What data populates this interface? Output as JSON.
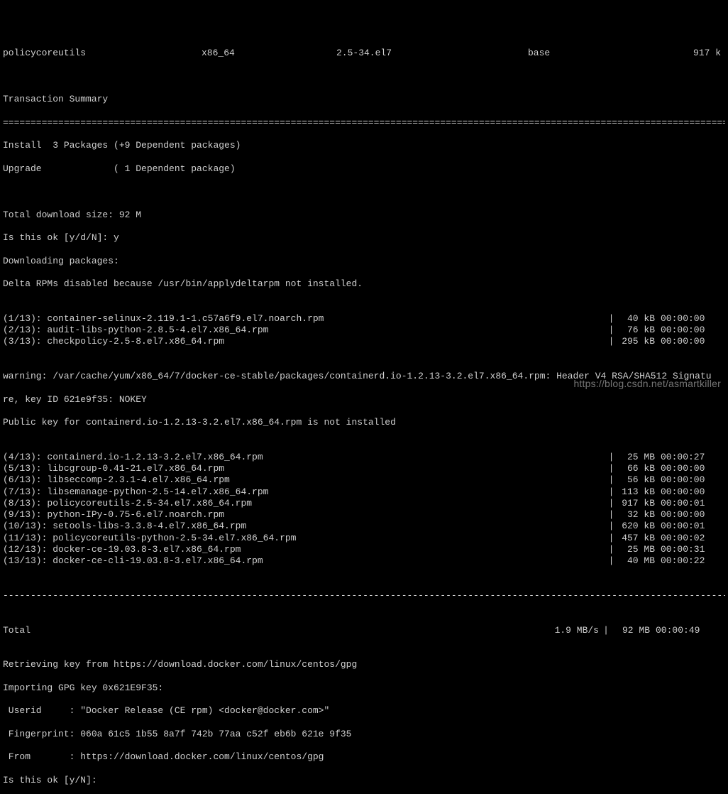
{
  "header": {
    "name": "policycoreutils",
    "arch": "x86_64",
    "version": "2.5-34.el7",
    "repo": "base",
    "size": "917 k"
  },
  "summary_title": "Transaction Summary",
  "divider": "========================================================================================================================================",
  "install_line": "Install  3 Packages (+9 Dependent packages)",
  "upgrade_line": "Upgrade             ( 1 Dependent package)",
  "download_size": "Total download size: 92 M",
  "prompt1": "Is this ok [y/d/N]: y",
  "downloading": "Downloading packages:",
  "delta_warn": "Delta RPMs disabled because /usr/bin/applydeltarpm not installed.",
  "pkgs": [
    {
      "label": "(1/13): container-selinux-2.119.1-1.c57a6f9.el7.noarch.rpm",
      "size": "40 kB",
      "time": "00:00:00"
    },
    {
      "label": "(2/13): audit-libs-python-2.8.5-4.el7.x86_64.rpm",
      "size": "76 kB",
      "time": "00:00:00"
    },
    {
      "label": "(3/13): checkpolicy-2.5-8.el7.x86_64.rpm",
      "size": "295 kB",
      "time": "00:00:00"
    }
  ],
  "warn1": "warning: /var/cache/yum/x86_64/7/docker-ce-stable/packages/containerd.io-1.2.13-3.2.el7.x86_64.rpm: Header V4 RSA/SHA512 Signatu",
  "warn2": "re, key ID 621e9f35: NOKEY",
  "pubkey": "Public key for containerd.io-1.2.13-3.2.el7.x86_64.rpm is not installed",
  "pkgs2": [
    {
      "label": "(4/13): containerd.io-1.2.13-3.2.el7.x86_64.rpm",
      "size": "25 MB",
      "time": "00:00:27"
    },
    {
      "label": "(5/13): libcgroup-0.41-21.el7.x86_64.rpm",
      "size": "66 kB",
      "time": "00:00:00"
    },
    {
      "label": "(6/13): libseccomp-2.3.1-4.el7.x86_64.rpm",
      "size": "56 kB",
      "time": "00:00:00"
    },
    {
      "label": "(7/13): libsemanage-python-2.5-14.el7.x86_64.rpm",
      "size": "113 kB",
      "time": "00:00:00"
    },
    {
      "label": "(8/13): policycoreutils-2.5-34.el7.x86_64.rpm",
      "size": "917 kB",
      "time": "00:00:01"
    },
    {
      "label": "(9/13): python-IPy-0.75-6.el7.noarch.rpm",
      "size": "32 kB",
      "time": "00:00:00"
    },
    {
      "label": "(10/13): setools-libs-3.3.8-4.el7.x86_64.rpm",
      "size": "620 kB",
      "time": "00:00:01"
    },
    {
      "label": "(11/13): policycoreutils-python-2.5-34.el7.x86_64.rpm",
      "size": "457 kB",
      "time": "00:00:02"
    },
    {
      "label": "(12/13): docker-ce-19.03.8-3.el7.x86_64.rpm",
      "size": "25 MB",
      "time": "00:00:31"
    },
    {
      "label": "(13/13): docker-ce-cli-19.03.8-3.el7.x86_64.rpm",
      "size": "40 MB",
      "time": "00:00:22"
    }
  ],
  "dash_divider": "----------------------------------------------------------------------------------------------------------------------------------------",
  "total": {
    "label": "Total",
    "speed": "1.9 MB/s",
    "size": "92 MB",
    "time": "00:00:49"
  },
  "retrieve": "Retrieving key from https://download.docker.com/linux/centos/gpg",
  "importing": "Importing GPG key 0x621E9F35:",
  "userid": " Userid     : \"Docker Release (CE rpm) <docker@docker.com>\"",
  "finger": " Fingerprint: 060a 61c5 1b55 8a7f 742b 77aa c52f eb6b 621e 9f35",
  "from": " From       : https://download.docker.com/linux/centos/gpg",
  "prompt2": "Is this ok [y/N]:",
  "watermark": "https://blog.csdn.net/asmartkiller"
}
